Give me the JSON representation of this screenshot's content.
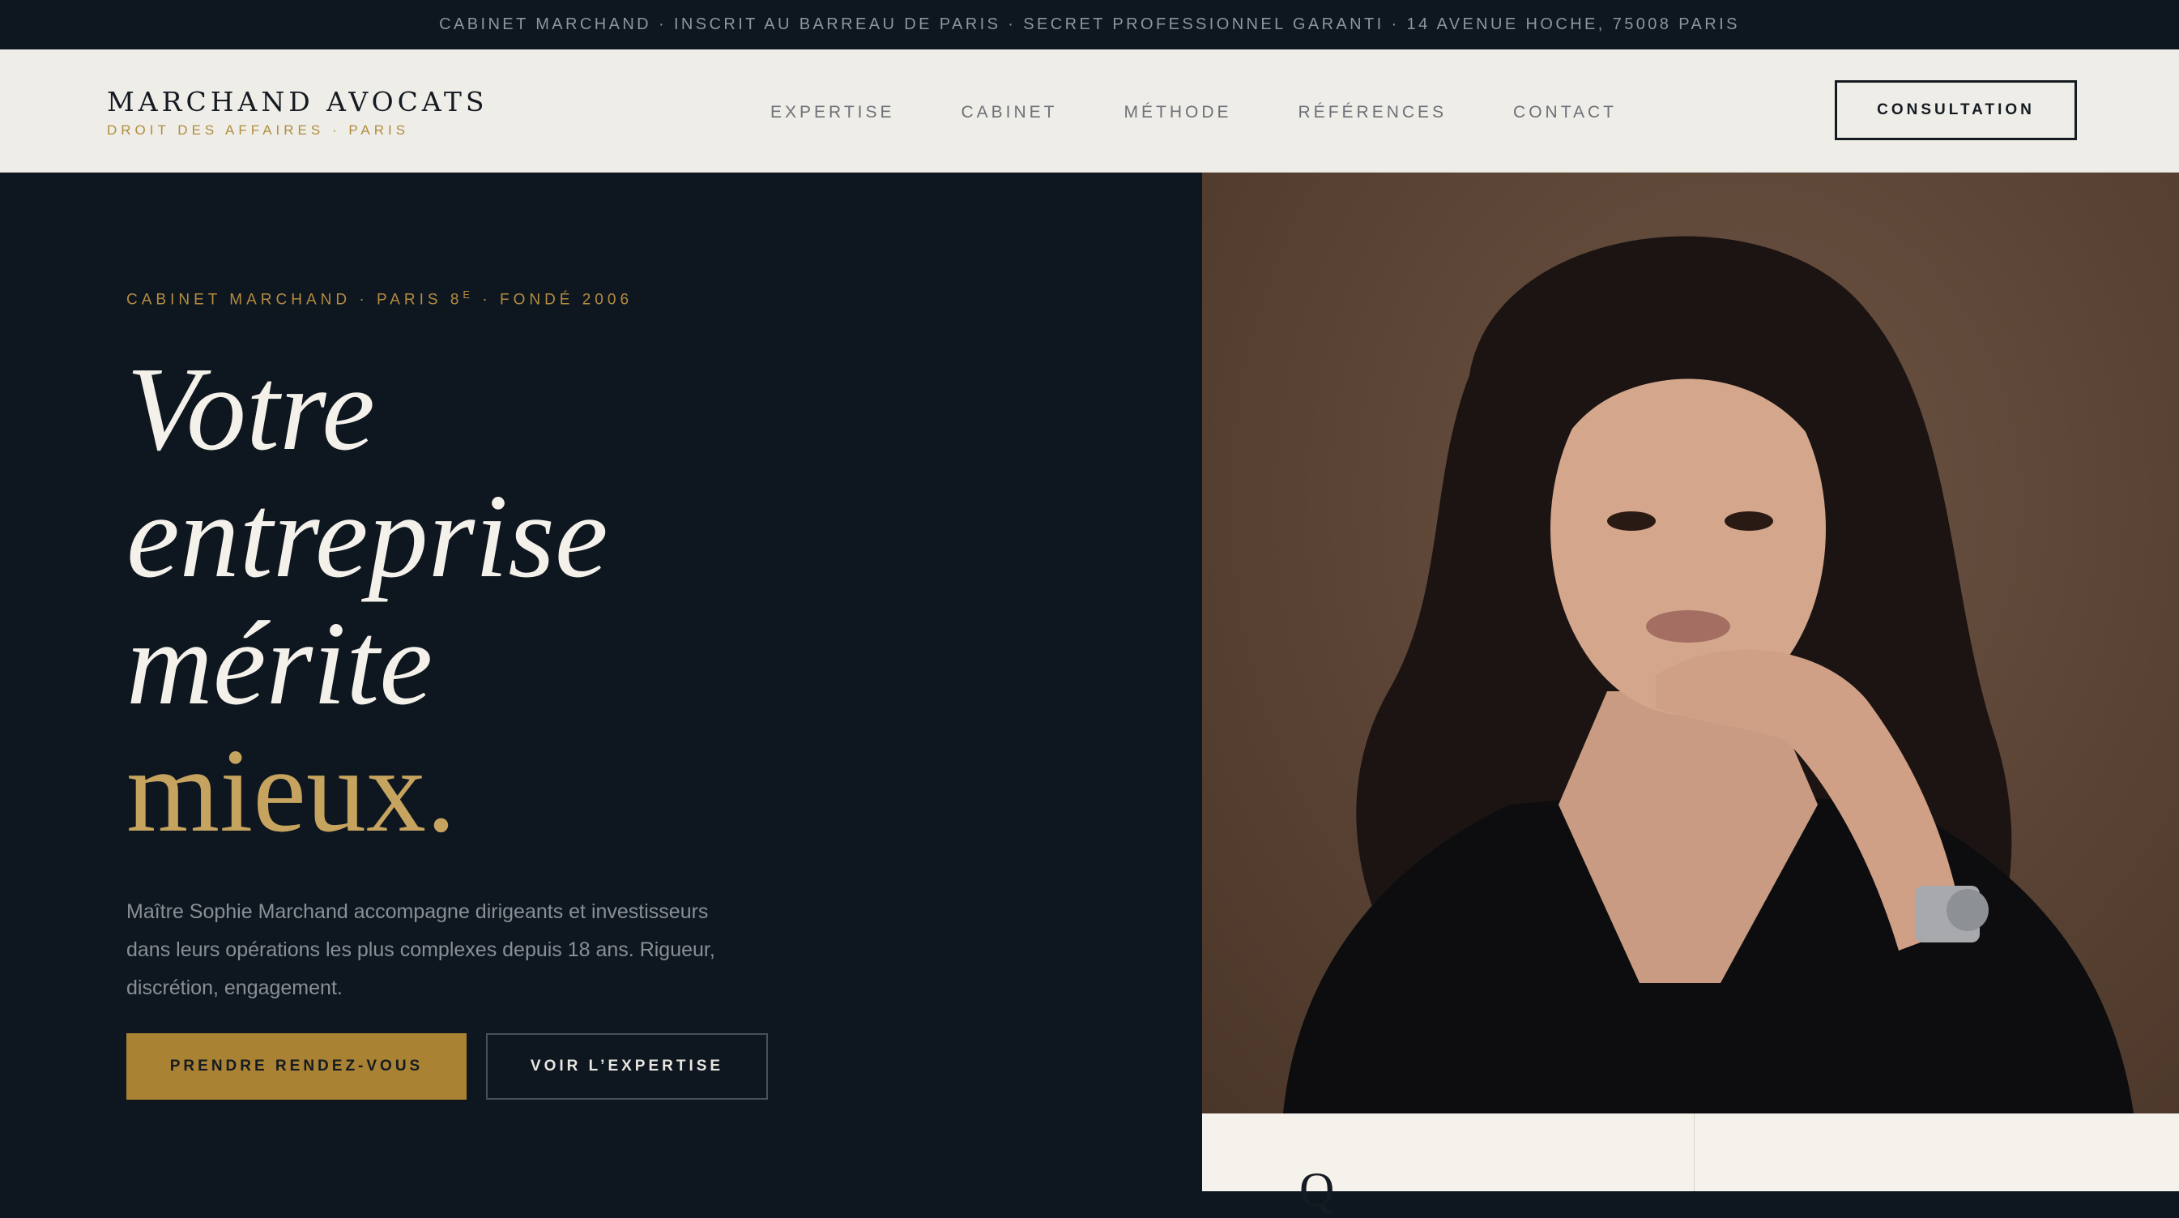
{
  "topbar": {
    "text": "CABINET MARCHAND · INSCRIT AU BARREAU DE PARIS · SECRET PROFESSIONNEL GARANTI · 14 AVENUE HOCHE, 75008 PARIS"
  },
  "header": {
    "logo_name": "MARCHAND AVOCATS",
    "logo_tagline": "DROIT DES AFFAIRES · PARIS",
    "nav": [
      "EXPERTISE",
      "CABINET",
      "MÉTHODE",
      "RÉFÉRENCES",
      "CONTACT"
    ],
    "cta_label": "CONSULTATION"
  },
  "hero": {
    "eyebrow_pre": "CABINET MARCHAND · PARIS 8",
    "eyebrow_sup": "E",
    "eyebrow_post": " · FONDÉ 2006",
    "headline_lines": [
      "Votre",
      "entreprise",
      "mérite"
    ],
    "headline_accent": "mieux.",
    "lede": "Maître Sophie Marchand accompagne dirigeants et investisseurs dans leurs opérations les plus complexes depuis 18 ans. Rigueur, discrétion, engagement.",
    "primary_cta": "PRENDRE RENDEZ-VOUS",
    "secondary_cta": "VOIR L’EXPERTISE"
  },
  "card": {
    "glyph": "Q"
  },
  "colors": {
    "navy": "#0e1620",
    "gold": "#b48c3f",
    "cream": "#efede8",
    "portrait_bg": "#5a4334"
  }
}
